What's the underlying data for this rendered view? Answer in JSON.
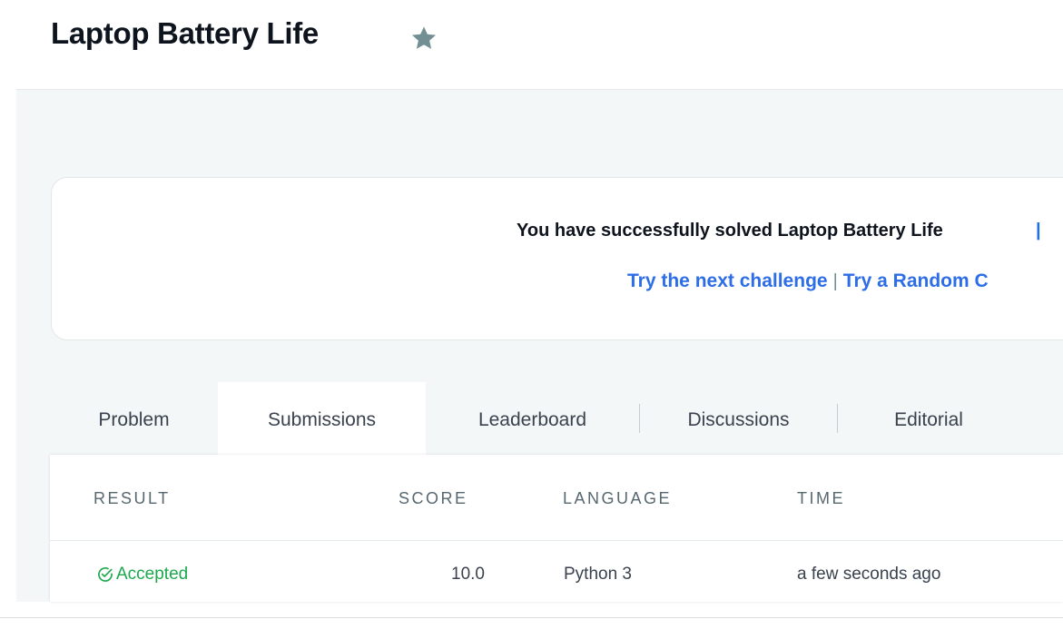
{
  "header": {
    "title": "Laptop Battery Life",
    "star_icon": "star-icon",
    "star_color": "#738f93"
  },
  "success_banner": {
    "message": "You have successfully solved Laptop Battery Life",
    "separator": "|",
    "next_challenge_link": "Try the next challenge",
    "link_separator": "|",
    "random_challenge_link": "Try a Random C",
    "link_color": "#2d6ee8"
  },
  "tabs": [
    {
      "label": "Problem",
      "active": false
    },
    {
      "label": "Submissions",
      "active": true
    },
    {
      "label": "Leaderboard",
      "active": false
    },
    {
      "label": "Discussions",
      "active": false
    },
    {
      "label": "Editorial",
      "active": false
    }
  ],
  "submissions": {
    "columns": [
      "RESULT",
      "SCORE",
      "LANGUAGE",
      "TIME"
    ],
    "rows": [
      {
        "result": "Accepted",
        "result_icon": "check-circle-icon",
        "result_color": "#1ba94c",
        "score": "10.0",
        "language": "Python 3",
        "time": "a few seconds ago"
      }
    ]
  }
}
